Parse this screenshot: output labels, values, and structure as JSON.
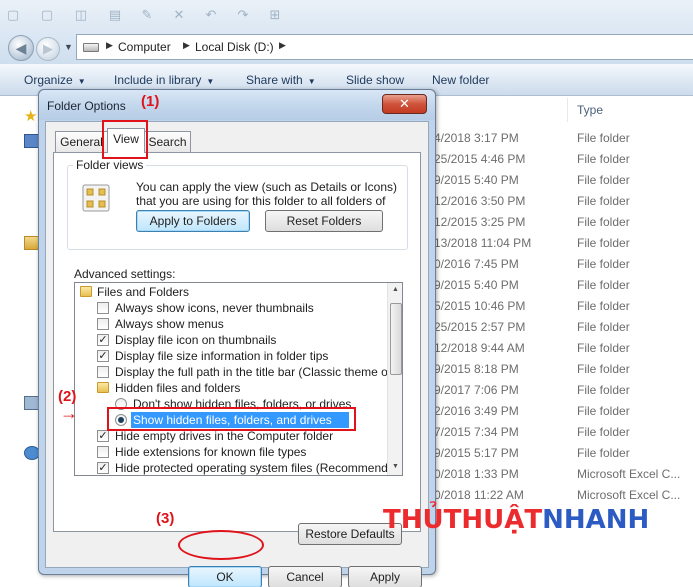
{
  "breadcrumb": [
    "Computer",
    "Local Disk (D:)"
  ],
  "toolbar": {
    "organize": "Organize",
    "include_in_library": "Include in library",
    "share_with": "Share with",
    "slide_show": "Slide show",
    "new_folder": "New folder"
  },
  "columns": {
    "type": "Type"
  },
  "file_rows": [
    {
      "date": "4/2018 3:17 PM",
      "type": "File folder"
    },
    {
      "date": "25/2015 4:46 PM",
      "type": "File folder"
    },
    {
      "date": "9/2015 5:40 PM",
      "type": "File folder"
    },
    {
      "date": "12/2016 3:50 PM",
      "type": "File folder"
    },
    {
      "date": "12/2015 3:25 PM",
      "type": "File folder"
    },
    {
      "date": "13/2018 11:04 PM",
      "type": "File folder"
    },
    {
      "date": "0/2016 7:45 PM",
      "type": "File folder"
    },
    {
      "date": "9/2015 5:40 PM",
      "type": "File folder"
    },
    {
      "date": "5/2015 10:46 PM",
      "type": "File folder"
    },
    {
      "date": "25/2015 2:57 PM",
      "type": "File folder"
    },
    {
      "date": "12/2018 9:44 AM",
      "type": "File folder"
    },
    {
      "date": "9/2015 8:18 PM",
      "type": "File folder"
    },
    {
      "date": "9/2017 7:06 PM",
      "type": "File folder"
    },
    {
      "date": "2/2016 3:49 PM",
      "type": "File folder"
    },
    {
      "date": "7/2015 7:34 PM",
      "type": "File folder"
    },
    {
      "date": "9/2015 5:17 PM",
      "type": "File folder"
    },
    {
      "date": "0/2018 1:33 PM",
      "type": "Microsoft Excel C..."
    },
    {
      "date": "0/2018 11:22 AM",
      "type": "Microsoft Excel C..."
    }
  ],
  "dialog": {
    "title": "Folder Options",
    "close_label": "✕",
    "tabs": [
      "General",
      "View",
      "Search"
    ],
    "folder_views": {
      "legend": "Folder views",
      "description": "You can apply the view (such as Details or Icons) that you are using for this folder to all folders of this type.",
      "apply_label": "Apply to Folders",
      "reset_label": "Reset Folders"
    },
    "advanced_label": "Advanced settings:",
    "advanced_items": [
      {
        "label": "Files and Folders",
        "kind": "folder"
      },
      {
        "label": "Always show icons, never thumbnails",
        "kind": "checkbox",
        "checked": false
      },
      {
        "label": "Always show menus",
        "kind": "checkbox",
        "checked": false
      },
      {
        "label": "Display file icon on thumbnails",
        "kind": "checkbox",
        "checked": true
      },
      {
        "label": "Display file size information in folder tips",
        "kind": "checkbox",
        "checked": true
      },
      {
        "label": "Display the full path in the title bar (Classic theme only)",
        "kind": "checkbox",
        "checked": false
      },
      {
        "label": "Hidden files and folders",
        "kind": "folder"
      },
      {
        "label": "Don't show hidden files, folders, or drives",
        "kind": "radio",
        "checked": false
      },
      {
        "label": "Show hidden files, folders, and drives",
        "kind": "radio",
        "checked": true
      },
      {
        "label": "Hide empty drives in the Computer folder",
        "kind": "checkbox",
        "checked": true
      },
      {
        "label": "Hide extensions for known file types",
        "kind": "checkbox",
        "checked": false
      },
      {
        "label": "Hide protected operating system files (Recommended)",
        "kind": "checkbox",
        "checked": true
      }
    ],
    "restore_defaults_label": "Restore Defaults",
    "ok_label": "OK",
    "cancel_label": "Cancel",
    "apply_label": "Apply"
  },
  "annotations": {
    "step1": "(1)",
    "step2": "(2)",
    "step3": "(3)"
  },
  "watermark": {
    "part1": "THỦTHUẬT",
    "part2": "NHANH"
  },
  "colors": {
    "annotation_red": "#e0131a",
    "selection_blue": "#3399ff",
    "watermark_red": "#ec2b2e",
    "watermark_blue": "#2d5bc4"
  }
}
